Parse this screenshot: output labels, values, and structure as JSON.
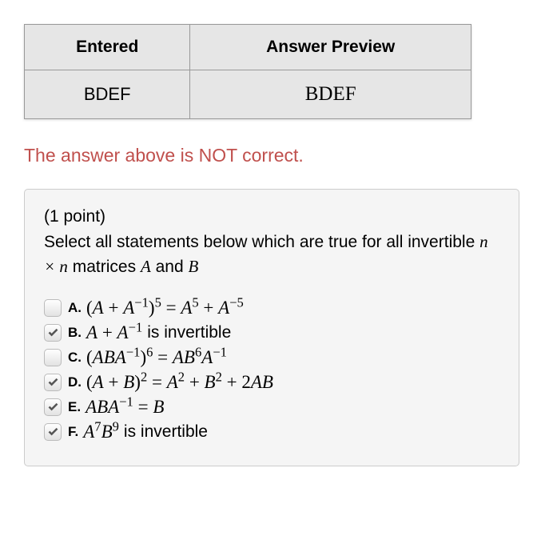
{
  "table": {
    "header_entered": "Entered",
    "header_preview": "Answer Preview",
    "value_entered": "BDEF",
    "value_preview": "BDEF"
  },
  "feedback": "The answer above is NOT correct.",
  "question": {
    "points": "(1 point)",
    "prompt_part1": "Select all statements below which are true for all invertible ",
    "prompt_matrices": "n × n",
    "prompt_part2": " matrices ",
    "prompt_A": "A",
    "prompt_and": " and ",
    "prompt_B": "B"
  },
  "options": {
    "a": {
      "label": "A.",
      "checked": false,
      "math": "(A + A⁻¹)⁵ = A⁵ + A⁻⁵"
    },
    "b": {
      "label": "B.",
      "checked": true,
      "math_prefix": "A + A⁻¹",
      "plain": " is invertible"
    },
    "c": {
      "label": "C.",
      "checked": false,
      "math": "(ABA⁻¹)⁶ = AB⁶A⁻¹"
    },
    "d": {
      "label": "D.",
      "checked": true,
      "math": "(A + B)² = A² + B² + 2AB"
    },
    "e": {
      "label": "E.",
      "checked": true,
      "math": "ABA⁻¹ = B"
    },
    "f": {
      "label": "F.",
      "checked": true,
      "math_prefix": "A⁷B⁹",
      "plain": " is invertible"
    }
  }
}
